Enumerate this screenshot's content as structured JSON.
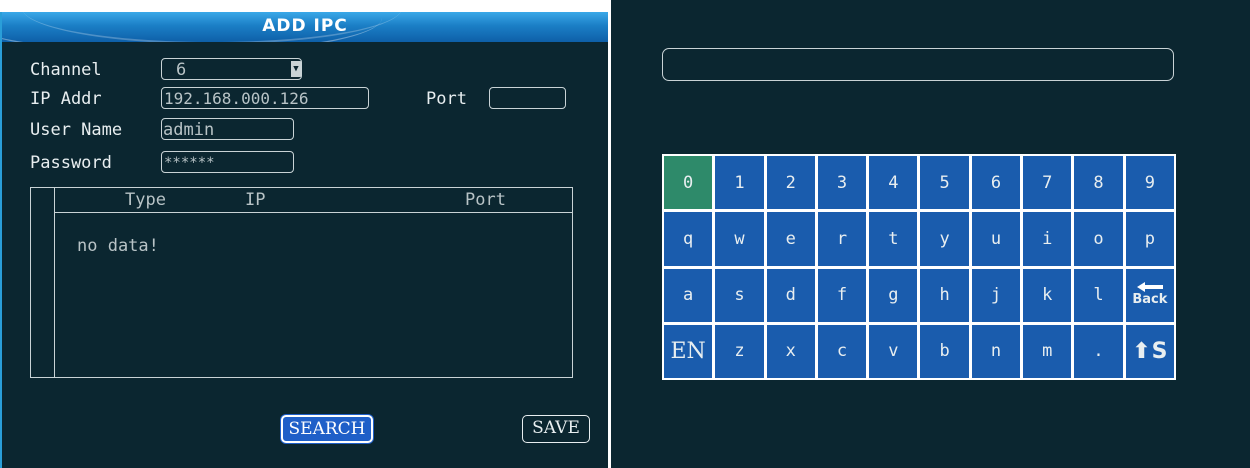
{
  "dialog": {
    "title": "ADD IPC",
    "channel_label": "Channel",
    "channel_value": "6",
    "ip_label": "IP Addr",
    "ip_value": "192.168.000.126",
    "port_label": "Port",
    "port_value": "",
    "username_label": "User Name",
    "username_value": "admin",
    "password_label": "Password",
    "password_value": "******",
    "table": {
      "columns": [
        "Type",
        "IP",
        "Port"
      ],
      "empty_text": "no data!"
    },
    "search_label": "SEARCH",
    "save_label": "SAVE"
  },
  "keyboard": {
    "input_value": "",
    "rows": [
      [
        "0",
        "1",
        "2",
        "3",
        "4",
        "5",
        "6",
        "7",
        "8",
        "9"
      ],
      [
        "q",
        "w",
        "e",
        "r",
        "t",
        "y",
        "u",
        "i",
        "o",
        "p"
      ],
      [
        "a",
        "s",
        "d",
        "f",
        "g",
        "h",
        "j",
        "k",
        "l",
        "Back"
      ],
      [
        "EN",
        "z",
        "x",
        "c",
        "v",
        "b",
        "n",
        "m",
        ".",
        "S"
      ]
    ],
    "active_key": "0"
  },
  "colors": {
    "background": "#0b2630",
    "key": "#1a5cad",
    "key_active": "#2e8a6a",
    "title_bar": "#1b7fc6",
    "search_button": "#1f5fc8"
  }
}
